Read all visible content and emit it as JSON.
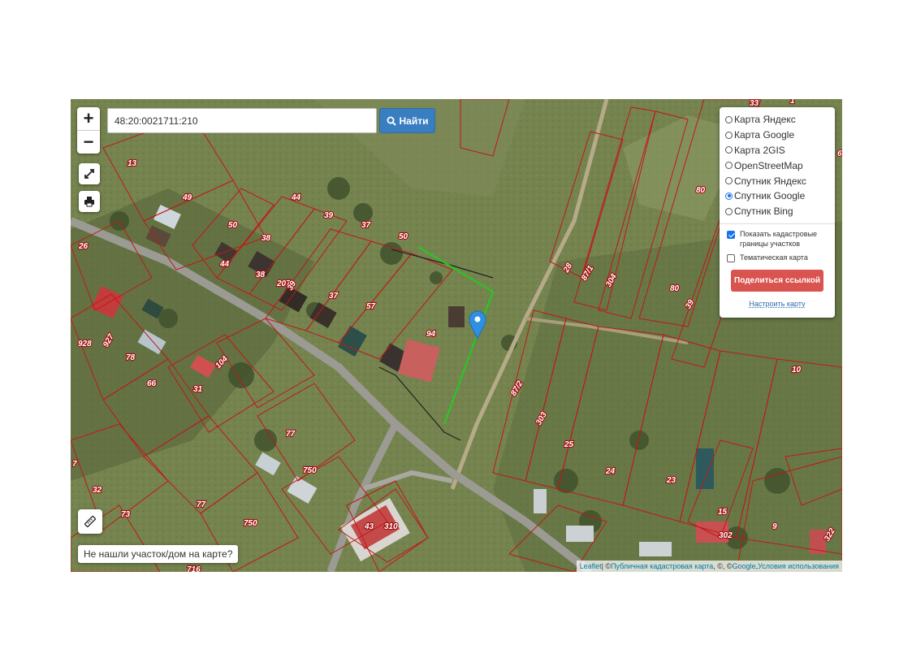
{
  "search": {
    "value": "48:20:0021711:210",
    "button_label": "Найти",
    "button_icon": "search-icon"
  },
  "controls": {
    "zoom_in": "+",
    "zoom_out": "−",
    "fullscreen_icon": "expand-icon",
    "print_icon": "printer-icon",
    "ruler_icon": "ruler-icon"
  },
  "layers": {
    "options": [
      {
        "label": "Карта Яндекс",
        "selected": false
      },
      {
        "label": "Карта Google",
        "selected": false
      },
      {
        "label": "Карта 2GIS",
        "selected": false
      },
      {
        "label": "OpenStreetMap",
        "selected": false
      },
      {
        "label": "Спутник Яндекс",
        "selected": false
      },
      {
        "label": "Спутник Google",
        "selected": true
      },
      {
        "label": "Спутник Bing",
        "selected": false
      }
    ],
    "show_boundaries": {
      "label": "Показать кадастровые границы участков",
      "checked": true
    },
    "thematic_map": {
      "label": "Тематическая карта",
      "checked": false
    },
    "share_button": "Поделиться ссылкой",
    "configure_link": "Настроить карту"
  },
  "not_found_button": "Не нашли участок/дом на карте?",
  "attribution": {
    "leaflet": "Leaflet",
    "sep1": " | © ",
    "pkk": "Публичная кадастровая карта",
    "middle": ", ©, © ",
    "google": "Google",
    "sep2": ", ",
    "terms": "Условия использования"
  },
  "plot_labels": [
    "13",
    "49",
    "50",
    "44",
    "38",
    "39",
    "37",
    "50",
    "44",
    "38",
    "207",
    "39",
    "37",
    "57",
    "94",
    "26",
    "928",
    "927",
    "78",
    "66",
    "31",
    "104",
    "77",
    "750",
    "73",
    "32",
    "77",
    "750",
    "43",
    "310",
    "28",
    "87/1",
    "304",
    "80",
    "80",
    "39",
    "87/2",
    "303",
    "25",
    "24",
    "23",
    "10",
    "15",
    "302",
    "9",
    "33",
    "1",
    "322",
    "7",
    "6",
    "716"
  ],
  "colors": {
    "parcel_border": "#c01818",
    "selected_parcel": "#22cc22",
    "marker": "#2f8fe0",
    "search_button": "#3a7ec2",
    "share_button": "#d9534f"
  }
}
